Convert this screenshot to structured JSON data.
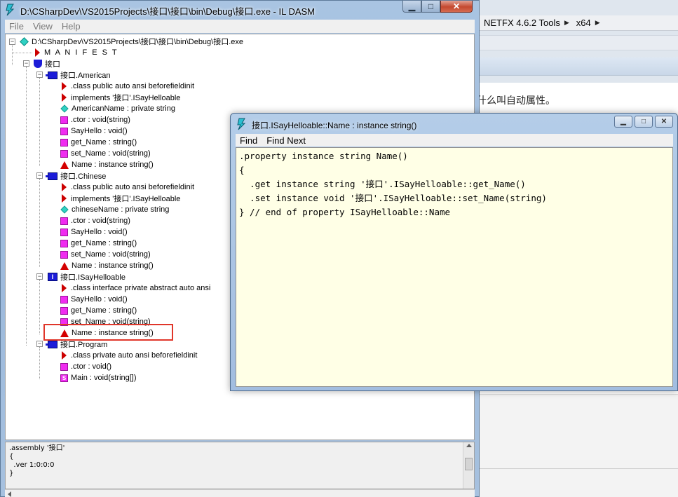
{
  "background_app": {
    "breadcrumb": [
      "NETFX 4.6.2 Tools",
      "x64"
    ],
    "content_text": "什么叫自动属性。"
  },
  "main_window": {
    "title": "D:\\CSharpDev\\VS2015Projects\\接口\\接口\\bin\\Debug\\接口.exe - IL DASM",
    "menu": [
      "File",
      "View",
      "Help"
    ],
    "tree": {
      "root": "D:\\CSharpDev\\VS2015Projects\\接口\\接口\\bin\\Debug\\接口.exe",
      "manifest": "M A N I F E S T",
      "namespace": "接口",
      "types": [
        {
          "name": "接口.American",
          "kind": "class",
          "members": [
            {
              "icon": "triangle",
              "label": ".class public auto ansi beforefieldinit"
            },
            {
              "icon": "triangle",
              "label": "implements '接口'.ISayHelloable"
            },
            {
              "icon": "field",
              "label": "AmericanName : private string"
            },
            {
              "icon": "method",
              "label": ".ctor : void(string)"
            },
            {
              "icon": "method",
              "label": "SayHello : void()"
            },
            {
              "icon": "method",
              "label": "get_Name : string()"
            },
            {
              "icon": "method",
              "label": "set_Name : void(string)"
            },
            {
              "icon": "property",
              "label": "Name : instance string()"
            }
          ]
        },
        {
          "name": "接口.Chinese",
          "kind": "class",
          "members": [
            {
              "icon": "triangle",
              "label": ".class public auto ansi beforefieldinit"
            },
            {
              "icon": "triangle",
              "label": "implements '接口'.ISayHelloable"
            },
            {
              "icon": "field",
              "label": "chineseName : private string"
            },
            {
              "icon": "method",
              "label": ".ctor : void(string)"
            },
            {
              "icon": "method",
              "label": "SayHello : void()"
            },
            {
              "icon": "method",
              "label": "get_Name : string()"
            },
            {
              "icon": "method",
              "label": "set_Name : void(string)"
            },
            {
              "icon": "property",
              "label": "Name : instance string()"
            }
          ]
        },
        {
          "name": "接口.ISayHelloable",
          "kind": "interface",
          "members": [
            {
              "icon": "triangle",
              "label": ".class interface private abstract auto ansi"
            },
            {
              "icon": "method",
              "label": "SayHello : void()"
            },
            {
              "icon": "method",
              "label": "get_Name : string()"
            },
            {
              "icon": "method",
              "label": "set_Name : void(string)"
            },
            {
              "icon": "property",
              "label": "Name : instance string()"
            }
          ]
        },
        {
          "name": "接口.Program",
          "kind": "class",
          "members": [
            {
              "icon": "triangle",
              "label": ".class private auto ansi beforefieldinit"
            },
            {
              "icon": "method",
              "label": ".ctor : void()"
            },
            {
              "icon": "static",
              "label": "Main : void(string[])"
            }
          ]
        }
      ]
    },
    "bottom_pane": [
      ".assembly '接口'",
      "{",
      "  .ver 1:0:0:0",
      "}"
    ]
  },
  "popup": {
    "title": "接口.ISayHelloable::Name : instance string()",
    "menu": [
      "Find",
      "Find Next"
    ],
    "code": [
      ".property instance string Name()",
      "{",
      "  .get instance string '接口'.ISayHelloable::get_Name()",
      "  .set instance void '接口'.ISayHelloable::set_Name(string)",
      "} // end of property ISayHelloable::Name"
    ]
  },
  "colors": {
    "highlight_box": "#e0362a",
    "code_background": "#ffffe6"
  }
}
